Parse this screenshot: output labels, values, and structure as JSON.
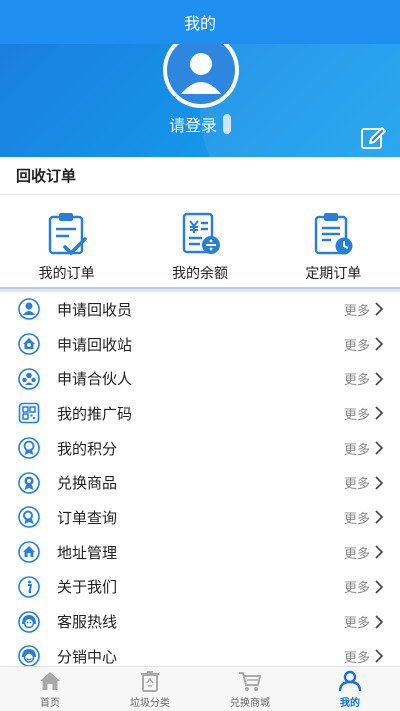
{
  "header": {
    "title": "我的"
  },
  "profile": {
    "login_text": "请登录"
  },
  "orders_section": {
    "title": "回收订单",
    "items": [
      {
        "label": "我的订单",
        "icon": "clipboard-check-icon"
      },
      {
        "label": "我的余额",
        "icon": "yuan-invoice-icon"
      },
      {
        "label": "定期订单",
        "icon": "clipboard-clock-icon"
      }
    ]
  },
  "menu": {
    "more_label": "更多",
    "items": [
      {
        "label": "申请回收员",
        "icon": "person-icon"
      },
      {
        "label": "申请回收站",
        "icon": "house-icon"
      },
      {
        "label": "申请合伙人",
        "icon": "partner-icon"
      },
      {
        "label": "我的推广码",
        "icon": "qrcode-icon"
      },
      {
        "label": "我的积分",
        "icon": "points-medal-icon"
      },
      {
        "label": "兑换商品",
        "icon": "exchange-medal-icon"
      },
      {
        "label": "订单查询",
        "icon": "order-search-icon"
      },
      {
        "label": "地址管理",
        "icon": "address-house-icon"
      },
      {
        "label": "关于我们",
        "icon": "info-icon"
      },
      {
        "label": "客服热线",
        "icon": "service-face-icon"
      },
      {
        "label": "分销中心",
        "icon": "distribution-face-icon"
      }
    ]
  },
  "tabbar": {
    "tabs": [
      {
        "label": "首页",
        "icon": "home-icon"
      },
      {
        "label": "垃圾分类",
        "icon": "trash-icon"
      },
      {
        "label": "兑换商城",
        "icon": "cart-icon"
      },
      {
        "label": "我的",
        "icon": "user-icon"
      }
    ]
  },
  "colors": {
    "primary": "#1f8ef1",
    "accent": "#1f6fd6",
    "icon_blue": "#2a7fd4"
  }
}
